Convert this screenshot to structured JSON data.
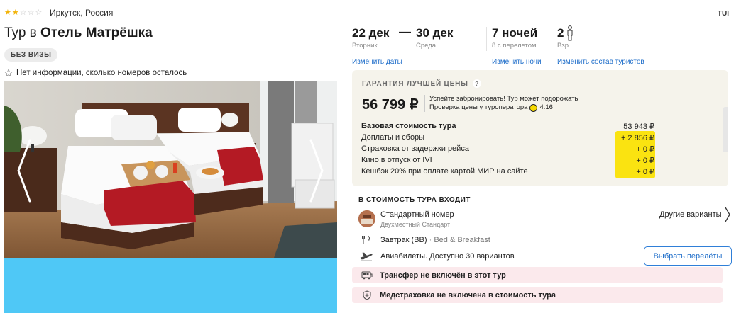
{
  "hotel": {
    "stars_filled": 2,
    "stars_total": 5,
    "location": "Иркутск, Россия",
    "title_prefix": "Тур в",
    "title_name": "Отель Матрёшка",
    "visa_badge": "БЕЗ ВИЗЫ",
    "rooms_info": "Нет информации, сколько номеров осталось"
  },
  "operator": "TUI",
  "dates": {
    "from": "22 дек",
    "from_day": "Вторник",
    "dash": "—",
    "to": "30 дек",
    "to_day": "Среда",
    "nights": "7 ночей",
    "nights_sub": "8 с перелетом",
    "tourists": "2",
    "tourists_sub": "Взр.",
    "change_dates": "Изменить даты",
    "change_nights": "Изменить ночи",
    "change_tourists": "Изменить состав туристов"
  },
  "price": {
    "guarantee": "ГАРАНТИЯ ЛУЧШЕЙ ЦЕНЫ",
    "qmark": "?",
    "total": "56 799 ₽",
    "urgent_line1": "Успейте забронировать! Тур может подорожать",
    "urgent_line2": "Проверка цены у туроператора",
    "timer": "4:16",
    "breakdown": [
      {
        "label": "Базовая стоимость тура",
        "value": "53 943 ₽"
      },
      {
        "label": "Доплаты и сборы",
        "value": "+ 2 856 ₽"
      },
      {
        "label": "Страховка от задержки рейса",
        "value": "+ 0 ₽"
      },
      {
        "label": "Кино в отпуск от IVI",
        "value": "+ 0 ₽"
      },
      {
        "label": "Кешбэк 20% при оплате картой МИР на сайте",
        "value": "+ 0 ₽"
      }
    ]
  },
  "included": {
    "title": "В СТОИМОСТЬ ТУРА ВХОДИТ",
    "room_name": "Стандартный номер",
    "room_sub": "Двухместный Стандарт",
    "other_options": "Другие варианты",
    "meal": "Завтрак (BB)",
    "meal_sep": "·",
    "meal_sub": "Bed & Breakfast",
    "flights": "Авиабилеты. Доступно 30 вариантов",
    "flights_button": "Выбрать перелёты",
    "transfer_warning": "Трансфер не включён в этот тур",
    "insurance_warning": "Медстраховка не включена в стоимость тура"
  },
  "colors": {
    "accent_blue": "#1c6cc9",
    "star": "#f2b308",
    "highlight_yellow": "#fae311",
    "warning_pink": "#fbe9ec",
    "price_box": "#f5f3eb",
    "placeholder_blue": "#4fc8f6"
  }
}
